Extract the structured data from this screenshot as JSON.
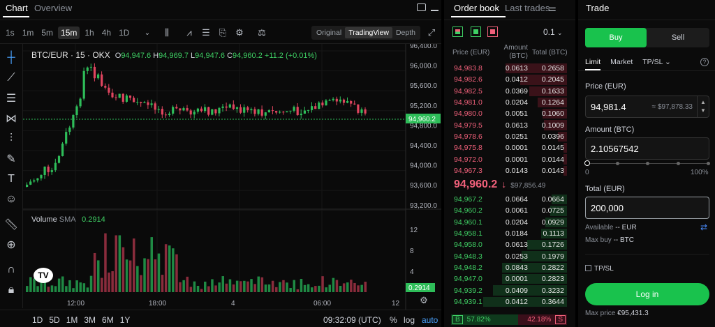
{
  "header": {
    "tab_chart": "Chart",
    "tab_overview": "Overview"
  },
  "intervals": [
    "1s",
    "1m",
    "5m",
    "15m",
    "1h",
    "4h",
    "1D"
  ],
  "active_interval": "15m",
  "views": {
    "original": "Original",
    "tradingview": "TradingView",
    "depth": "Depth"
  },
  "legend": {
    "symbol": "BTC/EUR · 15 · OKX",
    "o_label": "O",
    "o": "94,947.6",
    "h_label": "H",
    "h": "94,969.7",
    "l_label": "L",
    "l": "94,947.6",
    "c_label": "C",
    "c": "94,960.2",
    "change": "+11.2 (+0.01%)"
  },
  "price_axis": [
    "96,400.0",
    "96,000.0",
    "95,600.0",
    "95,200.0",
    "94,800.0",
    "94,400.0",
    "94,000.0",
    "93,600.0",
    "93,200.0"
  ],
  "current_price_label": "94,960.2",
  "volume": {
    "label": "Volume",
    "sma": "SMA",
    "value": "0.2914",
    "axis": [
      "12",
      "8",
      "4"
    ],
    "current": "0.2914"
  },
  "time_axis": [
    "12:00",
    "18:00",
    "4",
    "06:00",
    "12"
  ],
  "bottom_bar": {
    "ranges": [
      "1D",
      "5D",
      "1M",
      "3M",
      "6M",
      "1Y"
    ],
    "clock": "09:32:09 (UTC)",
    "percent": "%",
    "log": "log",
    "auto": "auto"
  },
  "orderbook": {
    "tab_book": "Order book",
    "tab_trades": "Last trades",
    "precision": "0.1",
    "col_price": "Price (EUR)",
    "col_amount": "Amount",
    "col_amount_unit": "(BTC)",
    "col_total": "Total (BTC)",
    "asks": [
      {
        "p": "94,983.8",
        "a": "0.0613",
        "t": "0.2658"
      },
      {
        "p": "94,982.6",
        "a": "0.0412",
        "t": "0.2045"
      },
      {
        "p": "94,982.5",
        "a": "0.0369",
        "t": "0.1633"
      },
      {
        "p": "94,981.0",
        "a": "0.0204",
        "t": "0.1264"
      },
      {
        "p": "94,980.0",
        "a": "0.0051",
        "t": "0.1060"
      },
      {
        "p": "94,979.5",
        "a": "0.0613",
        "t": "0.1009"
      },
      {
        "p": "94,978.6",
        "a": "0.0251",
        "t": "0.0396"
      },
      {
        "p": "94,975.8",
        "a": "0.0001",
        "t": "0.0145"
      },
      {
        "p": "94,972.0",
        "a": "0.0001",
        "t": "0.0144"
      },
      {
        "p": "94,967.3",
        "a": "0.0143",
        "t": "0.0143"
      }
    ],
    "mid_price": "94,960.2",
    "mid_arrow": "↓",
    "mid_ref": "$97,856.49",
    "bids": [
      {
        "p": "94,967.2",
        "a": "0.0664",
        "t": "0.0664"
      },
      {
        "p": "94,960.2",
        "a": "0.0061",
        "t": "0.0725"
      },
      {
        "p": "94,960.1",
        "a": "0.0204",
        "t": "0.0929"
      },
      {
        "p": "94,958.1",
        "a": "0.0184",
        "t": "0.1113"
      },
      {
        "p": "94,958.0",
        "a": "0.0613",
        "t": "0.1726"
      },
      {
        "p": "94,948.3",
        "a": "0.0253",
        "t": "0.1979"
      },
      {
        "p": "94,948.2",
        "a": "0.0843",
        "t": "0.2822"
      },
      {
        "p": "94,947.0",
        "a": "0.0001",
        "t": "0.2823"
      },
      {
        "p": "94,939.2",
        "a": "0.0409",
        "t": "0.3232"
      },
      {
        "p": "94,939.1",
        "a": "0.0412",
        "t": "0.3644"
      }
    ],
    "buy_ratio": "57.82%",
    "sell_ratio": "42.18%",
    "buy_letter": "B",
    "sell_letter": "S"
  },
  "trade": {
    "title": "Trade",
    "buy": "Buy",
    "sell": "Sell",
    "tabs": [
      "Limit",
      "Market",
      "TP/SL"
    ],
    "price_label": "Price (EUR)",
    "price_value": "94,981.4",
    "price_usd": "≈ $97,878.33",
    "amount_label": "Amount (BTC)",
    "amount_value": "2.10567542",
    "slider_min": "0",
    "slider_max": "100%",
    "total_label": "Total (EUR)",
    "total_value": "200,000",
    "available_label": "Available",
    "available_value": "-- EUR",
    "maxbuy_label": "Max buy",
    "maxbuy_value": "-- BTC",
    "tpsl": "TP/SL",
    "login": "Log in",
    "maxprice_label": "Max price",
    "maxprice_value": "€95,431.3"
  },
  "colors": {
    "up": "#2ebd59",
    "down": "#e0455f",
    "accent": "#19c24d"
  }
}
